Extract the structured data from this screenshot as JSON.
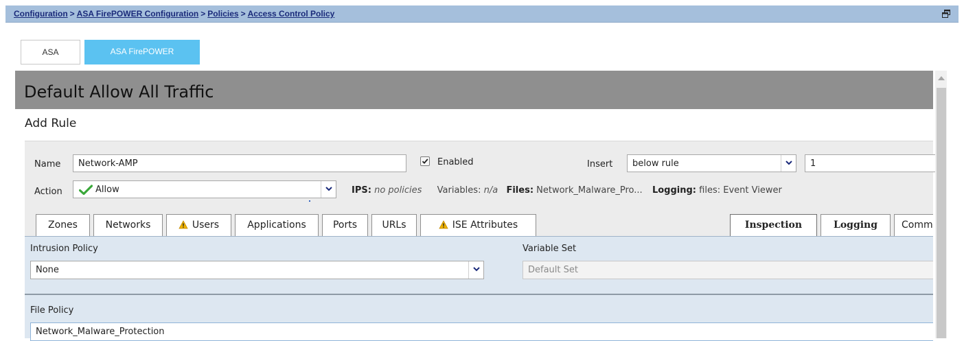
{
  "breadcrumb": {
    "items": [
      {
        "label": "Configuration"
      },
      {
        "label": "ASA FirePOWER Configuration"
      },
      {
        "label": "Policies"
      },
      {
        "label": "Access Control Policy"
      }
    ],
    "separator": ">"
  },
  "top_tabs": [
    {
      "label": "ASA",
      "active": false
    },
    {
      "label": "ASA FirePOWER",
      "active": true
    }
  ],
  "page_title": "Default Allow All Traffic",
  "add_rule_heading": "Add Rule",
  "form": {
    "name_label": "Name",
    "name_value": "Network-AMP",
    "enabled_label": "Enabled",
    "enabled_checked": true,
    "insert_label": "Insert",
    "insert_value": "below rule",
    "insert_position": "1",
    "action_label": "Action",
    "action_value": "Allow",
    "summary": {
      "ips_label": "IPS:",
      "ips_value": "no policies",
      "variables_label": "Variables:",
      "variables_value": "n/a",
      "files_label": "Files:",
      "files_value": "Network_Malware_Pro...",
      "logging_label": "Logging:",
      "logging_value": "files: Event Viewer"
    }
  },
  "rule_tabs_left": [
    {
      "label": "Zones",
      "warning": false
    },
    {
      "label": "Networks",
      "warning": false
    },
    {
      "label": "Users",
      "warning": true
    },
    {
      "label": "Applications",
      "warning": false
    },
    {
      "label": "Ports",
      "warning": false
    },
    {
      "label": "URLs",
      "warning": false
    },
    {
      "label": "ISE Attributes",
      "warning": true
    }
  ],
  "rule_tabs_right": [
    {
      "label": "Inspection",
      "active": true
    },
    {
      "label": "Logging",
      "active": false
    },
    {
      "label": "Comm",
      "active": false
    }
  ],
  "inspection": {
    "intrusion_policy_label": "Intrusion Policy",
    "intrusion_policy_value": "None",
    "variable_set_label": "Variable Set",
    "variable_set_value": "Default Set",
    "file_policy_label": "File Policy",
    "file_policy_value": "Network_Malware_Protection"
  },
  "colors": {
    "breadcrumb_bar": "#a5bfdc",
    "breadcrumb_link": "#1a2a7a",
    "active_top_tab": "#5bc2f1",
    "title_bar": "#8f8f8f",
    "allow_check": "#3aa83a",
    "warning": "#f0b400"
  },
  "icons": {
    "restore": "restore-window-icon",
    "allow": "green-check-icon",
    "warning": "warning-triangle-icon",
    "dropdown": "chevron-down-icon"
  }
}
